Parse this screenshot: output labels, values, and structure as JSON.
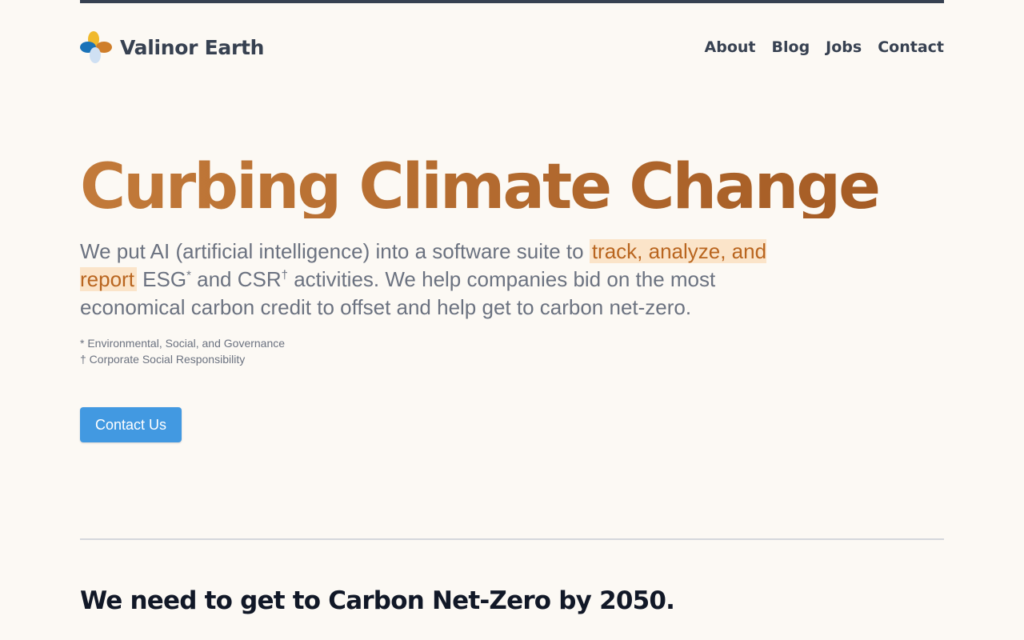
{
  "brand": {
    "name": "Valinor Earth",
    "logo_icon": "four-petal-logo-icon"
  },
  "nav": {
    "items": [
      {
        "label": "About"
      },
      {
        "label": "Blog"
      },
      {
        "label": "Jobs"
      },
      {
        "label": "Contact"
      }
    ]
  },
  "hero": {
    "title": "Curbing Climate Change",
    "text_part1": "We put AI (artificial intelligence) into a software suite to ",
    "highlight": "track, analyze, and report",
    "text_part2": " ESG",
    "sup1": "*",
    "text_part3": " and CSR",
    "sup2": "†",
    "text_part4": " activities. We help companies bid on the most economical carbon credit to offset and help get to carbon net-zero.",
    "footnote1": "* Environmental, Social, and Governance",
    "footnote2": "† Corporate Social Responsibility",
    "cta_label": "Contact Us"
  },
  "section2": {
    "title": "We need to get to Carbon Net-Zero by 2050."
  },
  "colors": {
    "accent_blue": "#4299e1",
    "title_orange": "#c27a3a",
    "highlight_bg": "#fbe4c9",
    "page_bg": "#fcf9f4"
  }
}
